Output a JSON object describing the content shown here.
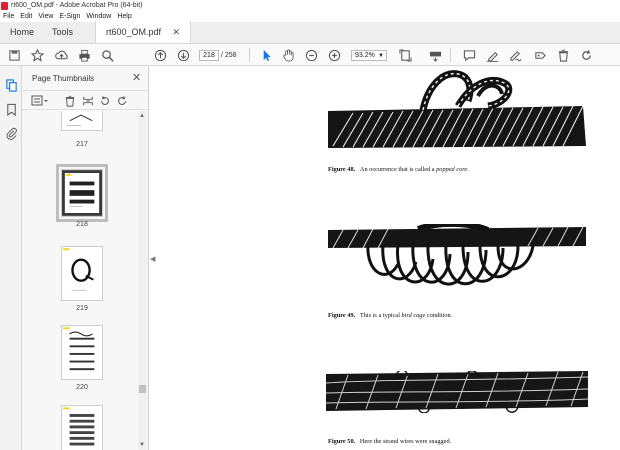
{
  "window": {
    "title": "rt600_OM.pdf - Adobe Acrobat Pro (64-bit)"
  },
  "menu": [
    "File",
    "Edit",
    "View",
    "E-Sign",
    "Window",
    "Help"
  ],
  "tabs": {
    "home": "Home",
    "tools": "Tools",
    "document": "rt600_OM.pdf"
  },
  "toolbar": {
    "page_current": "218",
    "page_total": "/ 258",
    "zoom": "93.2%"
  },
  "panel": {
    "title": "Page Thumbnails"
  },
  "thumbnails": [
    {
      "label": "217"
    },
    {
      "label": "218",
      "selected": true
    },
    {
      "label": "219"
    },
    {
      "label": "220"
    }
  ],
  "document": {
    "figures": [
      {
        "label": "Figure 48.",
        "text_before": "An occurrence that is called a ",
        "emphasis": "popped core",
        "text_after": "."
      },
      {
        "label": "Figure 49.",
        "text_before": "This is a typical ",
        "emphasis": "bird cage",
        "text_after": " condition."
      },
      {
        "label": "Figure 50.",
        "text_before": "Here the strand wires were snagged.",
        "emphasis": "",
        "text_after": ""
      }
    ]
  },
  "colors": {
    "accent": "#1473e6",
    "pdf_red": "#d9232e",
    "tab_bg": "#eeeeee"
  }
}
